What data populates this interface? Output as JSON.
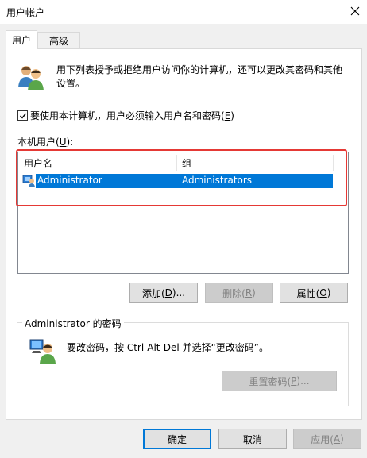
{
  "window": {
    "title": "用户帐户"
  },
  "tabs": [
    {
      "label": "用户",
      "active": true
    },
    {
      "label": "高级",
      "active": false
    }
  ],
  "users_tab": {
    "description": "用下列表授予或拒绝用户访问你的计算机，还可以更改其密码和其他设置。",
    "require_login": {
      "label_pre": "要使用本计算机，用户必须输入用户名和密码(",
      "accel": "E",
      "label_post": ")",
      "checked": true
    },
    "local_users": {
      "label_pre": "本机用户(",
      "accel": "U",
      "label_post": "):"
    },
    "columns": [
      "用户名",
      "组"
    ],
    "rows": [
      {
        "username": "Administrator",
        "group": "Administrators",
        "selected": true
      }
    ],
    "buttons": {
      "add": {
        "pre": "添加(",
        "accel": "D",
        "post": ")..."
      },
      "remove": {
        "pre": "删除(",
        "accel": "R",
        "post": ")"
      },
      "properties": {
        "pre": "属性(",
        "accel": "O",
        "post": ")"
      }
    },
    "password_group": {
      "title": "Administrator 的密码",
      "text": "要改密码，按 Ctrl-Alt-Del 并选择“更改密码”。",
      "reset": {
        "pre": "重置密码(",
        "accel": "P",
        "post": ")..."
      }
    }
  },
  "footer": {
    "ok": "确定",
    "cancel": "取消",
    "apply": {
      "pre": "应用(",
      "accel": "A",
      "post": ")"
    }
  },
  "icons": {
    "users": "users-icon",
    "key_user": "user-key-icon",
    "close": "close-icon",
    "check": "check-icon"
  },
  "colors": {
    "selection": "#0078d7",
    "highlight_box": "#e53935",
    "primary_border": "#0078d7"
  }
}
